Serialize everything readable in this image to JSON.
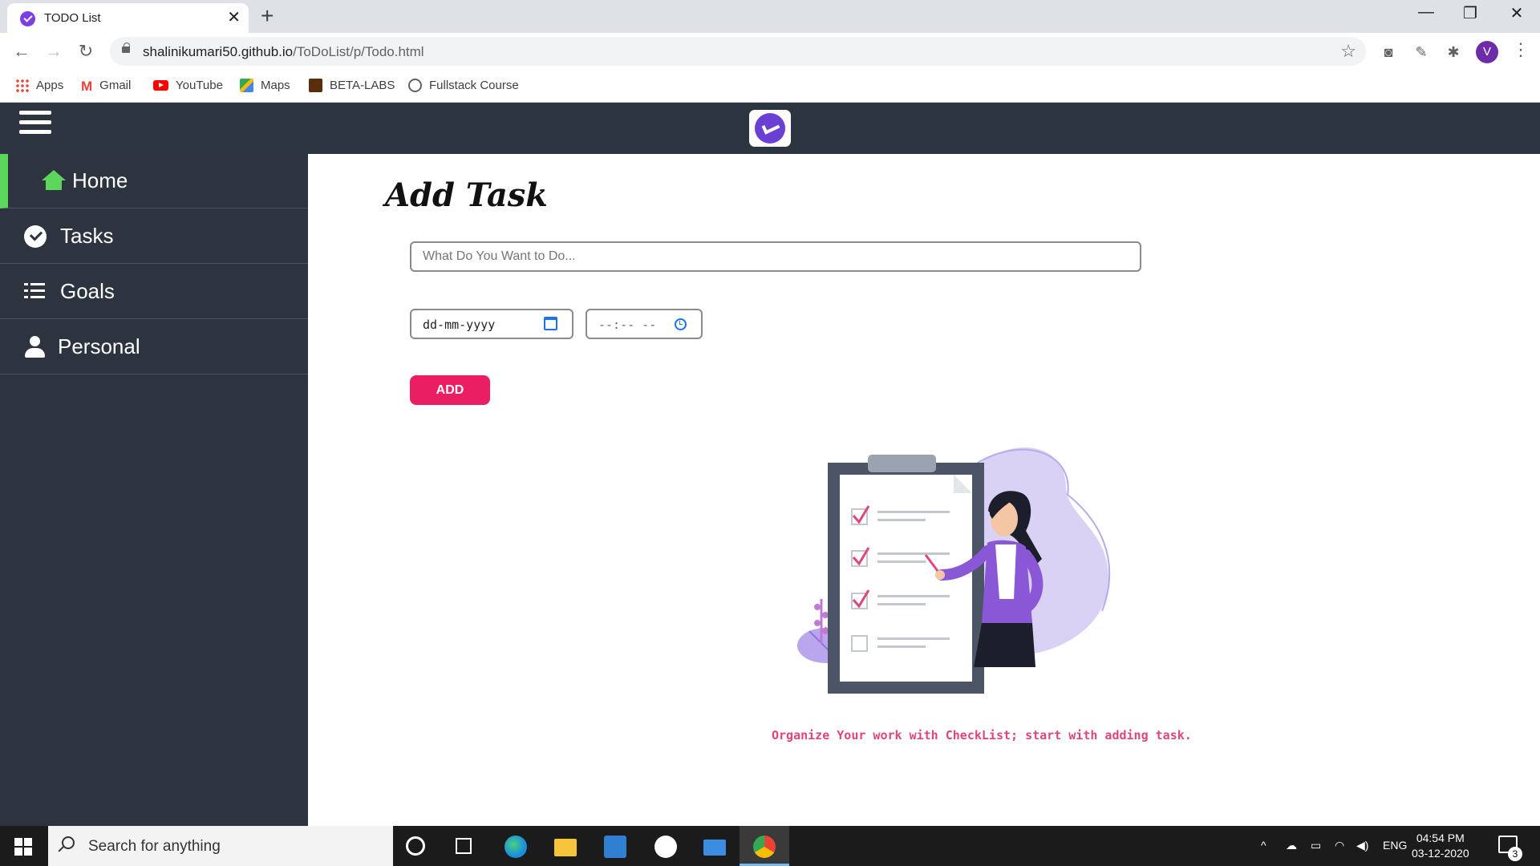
{
  "browser": {
    "tab_title": "TODO List",
    "tab_close": "✕",
    "new_tab": "+",
    "url_host": "shalinikumari50.github.io",
    "url_path": "/ToDoList/p/Todo.html",
    "profile_initial": "V",
    "window_controls": {
      "minimize": "—",
      "restore": "❐",
      "close": "✕"
    },
    "nav": {
      "back": "←",
      "forward": "→",
      "reload": "↻"
    },
    "bookmarks": [
      {
        "label": "Apps",
        "icon": "apps-grid-icon"
      },
      {
        "label": "Gmail",
        "icon": "gmail-icon"
      },
      {
        "label": "YouTube",
        "icon": "youtube-icon"
      },
      {
        "label": "Maps",
        "icon": "maps-icon"
      },
      {
        "label": "BETA-LABS",
        "icon": "beta-labs-icon"
      },
      {
        "label": "Fullstack Course",
        "icon": "globe-icon"
      }
    ]
  },
  "sidebar": {
    "items": [
      {
        "label": "Home",
        "icon": "home-icon",
        "active": true
      },
      {
        "label": "Tasks",
        "icon": "check-circle-icon"
      },
      {
        "label": "Goals",
        "icon": "list-check-icon"
      },
      {
        "label": "Personal",
        "icon": "user-icon"
      }
    ]
  },
  "main": {
    "title": "Add Task",
    "task_placeholder": "What Do You Want to Do...",
    "date_placeholder": "dd-mm-yyyy",
    "time_placeholder": "--:-- --",
    "add_label": "ADD",
    "tagline": "Organize Your work with CheckList; start with adding task."
  },
  "taskbar": {
    "search_placeholder": "Search for anything",
    "language": "ENG",
    "time": "04:54 PM",
    "date": "03-12-2020",
    "notification_count": "3"
  },
  "colors": {
    "header_bg": "#2c3440",
    "sidebar_bg": "#2d3440",
    "active_accent": "#5cd65c",
    "add_button": "#e91e63",
    "tagline": "#e0457b",
    "brand_purple": "#6a3fd4"
  }
}
